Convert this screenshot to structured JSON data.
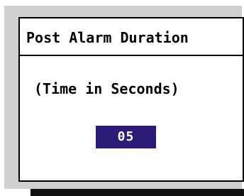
{
  "dialog": {
    "title": "Post Alarm Duration",
    "subtitle": "(Time in Seconds)",
    "value": "05"
  },
  "colors": {
    "panel_bg": "#d0d0d0",
    "dialog_bg": "#ffffff",
    "border": "#000000",
    "value_bg": "#2b1d77",
    "value_text": "#ffffff",
    "footer_bar": "#111111"
  }
}
